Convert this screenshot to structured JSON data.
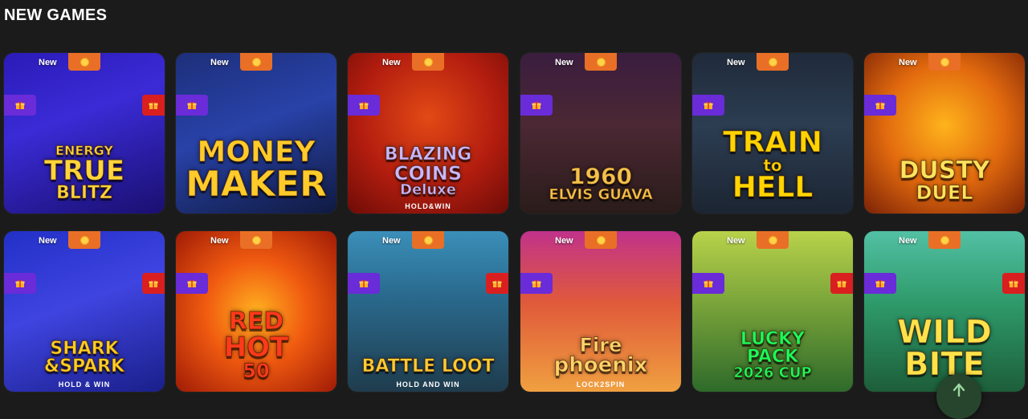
{
  "section": {
    "title": "NEW GAMES"
  },
  "games": [
    {
      "name_lines": [
        "ENERGY",
        "TRUE",
        "BLITZ"
      ],
      "tagline": "",
      "badge": "New",
      "bg": "linear-gradient(160deg,#2b1bb8 0%,#3a2bd6 40%,#1a0f70 100%)",
      "text_color": "#ffd53a",
      "has_right_gift": true
    },
    {
      "name_lines": [
        "MONEY",
        "MAKER"
      ],
      "tagline": "",
      "badge": "New",
      "bg": "linear-gradient(160deg,#1d2f7a 0%,#2842a8 45%,#101a40 100%)",
      "text_color": "#ffcb2b",
      "has_right_gift": false
    },
    {
      "name_lines": [
        "BLAZING",
        "COINS",
        "Deluxe"
      ],
      "tagline": "HOLD&WIN",
      "badge": "New",
      "bg": "radial-gradient(circle at 50% 40%,#e24a15 0%,#b31d0f 55%,#6d0c07 100%)",
      "text_color": "#c9b8ff",
      "has_right_gift": false
    },
    {
      "name_lines": [
        "1960",
        "ELVIS GUAVA"
      ],
      "tagline": "",
      "badge": "New",
      "bg": "linear-gradient(180deg,#3a1d3f 0%,#4b2834 45%,#2a1c1a 100%)",
      "text_color": "#f2c24c",
      "has_right_gift": false
    },
    {
      "name_lines": [
        "TRAIN",
        "to",
        "HELL"
      ],
      "tagline": "",
      "badge": "New",
      "bg": "linear-gradient(180deg,#1f2a3a 0%,#2c3d52 45%,#1c2532 100%)",
      "text_color": "#ffd400",
      "has_right_gift": false
    },
    {
      "name_lines": [
        "DUSTY",
        "DUEL"
      ],
      "tagline": "",
      "badge": "New",
      "bg": "radial-gradient(circle at 50% 45%,#ffb31c 0%,#e26a0e 50%,#7b2206 100%)",
      "text_color": "#ffe35c",
      "has_right_gift": false
    },
    {
      "name_lines": [
        "SHARK",
        "&SPARK"
      ],
      "tagline": "HOLD & WIN",
      "badge": "New",
      "bg": "linear-gradient(160deg,#2230c7 0%,#3f44e0 45%,#1a1f8a 100%)",
      "text_color": "#ffcf22",
      "has_right_gift": true
    },
    {
      "name_lines": [
        "RED",
        "HOT",
        "50"
      ],
      "tagline": "",
      "badge": "New",
      "bg": "radial-gradient(circle at 50% 50%,#ffb020 0%,#f05a10 45%,#a01b06 100%)",
      "text_color": "#ff3a1a",
      "has_right_gift": false
    },
    {
      "name_lines": [
        "BATTLE LOOT"
      ],
      "tagline": "HOLD AND WIN",
      "badge": "New",
      "bg": "linear-gradient(180deg,#3a8fb9 0%,#2a6a8e 40%,#1f3c4d 100%)",
      "text_color": "#ffcc33",
      "has_right_gift": true
    },
    {
      "name_lines": [
        "Fire",
        "phoenix"
      ],
      "tagline": "LOCK2SPIN",
      "badge": "New",
      "bg": "linear-gradient(180deg,#c0328a 0%,#e05a3a 45%,#f0a040 100%)",
      "text_color": "#ffd46a",
      "has_right_gift": false
    },
    {
      "name_lines": [
        "LUCKY",
        "PACK",
        "2026 CUP"
      ],
      "tagline": "",
      "badge": "New",
      "bg": "linear-gradient(180deg,#b8d24a 0%,#7aa43a 45%,#2e6a2a 100%)",
      "text_color": "#1aff5a",
      "has_right_gift": true
    },
    {
      "name_lines": [
        "WILD",
        "BITE"
      ],
      "tagline": "",
      "badge": "New",
      "bg": "linear-gradient(180deg,#52c0a4 0%,#2e9a6a 45%,#1d5e3a 100%)",
      "text_color": "#ffe24a",
      "has_right_gift": true
    }
  ],
  "icons": {
    "coin": "coin-icon",
    "gift": "gift-icon",
    "scroll_top": "arrow-up-icon"
  },
  "colors": {
    "coin_tab": "#e96f26",
    "gift_left": "#6a2bd8",
    "gift_right": "#d91f1f",
    "background": "#1b1b1b"
  }
}
